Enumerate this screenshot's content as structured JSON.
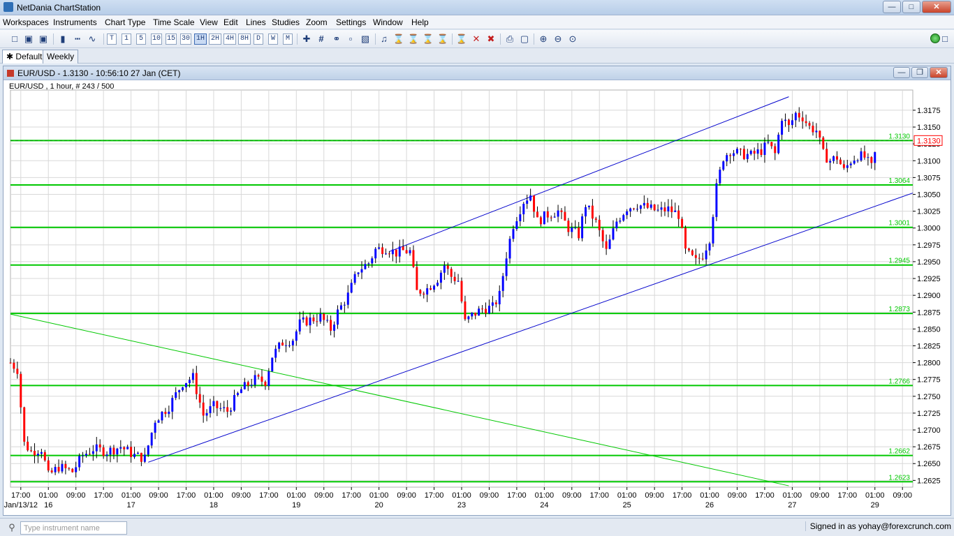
{
  "app": {
    "title": "NetDania ChartStation",
    "status_color": "#1b8f1b"
  },
  "menu": [
    "Workspaces",
    "Instruments",
    "Chart Type",
    "Time Scale",
    "View",
    "Edit",
    "Lines",
    "Studies",
    "Zoom",
    "Settings",
    "Window",
    "Help"
  ],
  "toolbar": {
    "timeframes": [
      "T",
      "1",
      "5",
      "10",
      "15",
      "30",
      "1H",
      "2H",
      "4H",
      "8H",
      "D",
      "W",
      "M"
    ],
    "selected_timeframe": "1H",
    "icons": [
      "new-icon",
      "save-icon",
      "save-as-icon",
      "candlestick-icon",
      "bar-icon",
      "line-icon",
      "crosshair-icon",
      "grid-icon",
      "marker-icon",
      "histogram-icon",
      "volume-icon",
      "alert-icon",
      "study-icon",
      "trend-icon",
      "study-b-icon",
      "study-c-icon",
      "delete-last-icon",
      "delete-icon",
      "delete-all-icon",
      "print-icon",
      "print-preview-icon",
      "zoom-in-icon",
      "zoom-out-icon",
      "zoom-reset-icon"
    ]
  },
  "tabs": [
    {
      "label": "Default",
      "active": true
    },
    {
      "label": "Weekly",
      "active": false
    }
  ],
  "chart_window": {
    "title": "EUR/USD - 1.3130 - 10:56:10  27 Jan (CET)",
    "info": "EUR/USD , 1 hour, # 243 / 500"
  },
  "chart_data": {
    "type": "candlestick",
    "instrument": "EUR/USD",
    "interval": "1 hour",
    "current_price": "1.3130",
    "ylim": [
      1.2615,
      1.3205
    ],
    "y_ticks": [
      "1.3175",
      "1.3150",
      "1.3125",
      "1.3100",
      "1.3075",
      "1.3050",
      "1.3025",
      "1.3000",
      "1.2975",
      "1.2950",
      "1.2925",
      "1.2900",
      "1.2875",
      "1.2850",
      "1.2825",
      "1.2800",
      "1.2775",
      "1.2750",
      "1.2725",
      "1.2700",
      "1.2675",
      "1.2650",
      "1.2625"
    ],
    "x_ticks": [
      {
        "t": 17,
        "time": "17:00",
        "date": "Jan/13/12"
      },
      {
        "t": 25,
        "time": "01:00",
        "date": "16"
      },
      {
        "t": 33,
        "time": "09:00",
        "date": ""
      },
      {
        "t": 41,
        "time": "17:00",
        "date": ""
      },
      {
        "t": 49,
        "time": "01:00",
        "date": "17"
      },
      {
        "t": 57,
        "time": "09:00",
        "date": ""
      },
      {
        "t": 65,
        "time": "17:00",
        "date": ""
      },
      {
        "t": 73,
        "time": "01:00",
        "date": "18"
      },
      {
        "t": 81,
        "time": "09:00",
        "date": ""
      },
      {
        "t": 89,
        "time": "17:00",
        "date": ""
      },
      {
        "t": 97,
        "time": "01:00",
        "date": "19"
      },
      {
        "t": 105,
        "time": "09:00",
        "date": ""
      },
      {
        "t": 113,
        "time": "17:00",
        "date": ""
      },
      {
        "t": 121,
        "time": "01:00",
        "date": "20"
      },
      {
        "t": 129,
        "time": "09:00",
        "date": ""
      },
      {
        "t": 137,
        "time": "17:00",
        "date": ""
      },
      {
        "t": 145,
        "time": "01:00",
        "date": "23"
      },
      {
        "t": 153,
        "time": "09:00",
        "date": ""
      },
      {
        "t": 161,
        "time": "17:00",
        "date": ""
      },
      {
        "t": 169,
        "time": "01:00",
        "date": "24"
      },
      {
        "t": 177,
        "time": "09:00",
        "date": ""
      },
      {
        "t": 185,
        "time": "17:00",
        "date": ""
      },
      {
        "t": 193,
        "time": "01:00",
        "date": "25"
      },
      {
        "t": 201,
        "time": "09:00",
        "date": ""
      },
      {
        "t": 209,
        "time": "17:00",
        "date": ""
      },
      {
        "t": 217,
        "time": "01:00",
        "date": "26"
      },
      {
        "t": 225,
        "time": "09:00",
        "date": ""
      },
      {
        "t": 233,
        "time": "17:00",
        "date": ""
      },
      {
        "t": 241,
        "time": "01:00",
        "date": "27"
      },
      {
        "t": 249,
        "time": "09:00",
        "date": ""
      },
      {
        "t": 257,
        "time": "17:00",
        "date": ""
      },
      {
        "t": 265,
        "time": "01:00",
        "date": "29"
      },
      {
        "t": 273,
        "time": "09:00",
        "date": ""
      }
    ],
    "x_range": [
      14,
      276
    ],
    "levels": [
      {
        "value": 1.313,
        "label": "1.3130",
        "color": "#00c800"
      },
      {
        "value": 1.3064,
        "label": "1.3064",
        "color": "#00c800"
      },
      {
        "value": 1.3001,
        "label": "1.3001",
        "color": "#00c800"
      },
      {
        "value": 1.2945,
        "label": "1.2945",
        "color": "#00c800"
      },
      {
        "value": 1.2873,
        "label": "1.2873",
        "color": "#00c800"
      },
      {
        "value": 1.2766,
        "label": "1.2766",
        "color": "#00c800"
      },
      {
        "value": 1.2662,
        "label": "1.2662",
        "color": "#00c800"
      },
      {
        "value": 1.2623,
        "label": "1.2623",
        "color": "#00c800"
      }
    ],
    "trendlines": [
      {
        "from": [
          14,
          1.2872
        ],
        "to": [
          240,
          1.2617
        ],
        "color": "#00c800"
      },
      {
        "from": [
          54,
          1.2652
        ],
        "to": [
          276,
          1.3052
        ],
        "color": "#0000cc"
      },
      {
        "from": [
          124,
          1.2965
        ],
        "to": [
          240,
          1.3195
        ],
        "color": "#0000cc"
      }
    ],
    "path_points": [
      [
        14,
        1.28
      ],
      [
        16,
        1.279
      ],
      [
        18,
        1.268
      ],
      [
        20,
        1.2668
      ],
      [
        23,
        1.2672
      ],
      [
        25,
        1.2632
      ],
      [
        28,
        1.2645
      ],
      [
        32,
        1.2638
      ],
      [
        35,
        1.2662
      ],
      [
        38,
        1.2672
      ],
      [
        42,
        1.2668
      ],
      [
        46,
        1.2675
      ],
      [
        50,
        1.2662
      ],
      [
        53,
        1.2658
      ],
      [
        56,
        1.2715
      ],
      [
        60,
        1.2735
      ],
      [
        64,
        1.277
      ],
      [
        67,
        1.2778
      ],
      [
        70,
        1.2722
      ],
      [
        73,
        1.2735
      ],
      [
        77,
        1.2728
      ],
      [
        81,
        1.276
      ],
      [
        85,
        1.2775
      ],
      [
        88,
        1.2772
      ],
      [
        90,
        1.281
      ],
      [
        93,
        1.283
      ],
      [
        96,
        1.2835
      ],
      [
        98,
        1.2858
      ],
      [
        100,
        1.2862
      ],
      [
        104,
        1.2868
      ],
      [
        107,
        1.285
      ],
      [
        109,
        1.2875
      ],
      [
        112,
        1.29
      ],
      [
        115,
        1.2938
      ],
      [
        118,
        1.2948
      ],
      [
        120,
        1.2968
      ],
      [
        123,
        1.297
      ],
      [
        126,
        1.2963
      ],
      [
        128,
        1.2966
      ],
      [
        130,
        1.2965
      ],
      [
        132,
        1.2905
      ],
      [
        135,
        1.291
      ],
      [
        138,
        1.2925
      ],
      [
        140,
        1.2945
      ],
      [
        142,
        1.2928
      ],
      [
        144,
        1.2922
      ],
      [
        146,
        1.286
      ],
      [
        148,
        1.287
      ],
      [
        151,
        1.288
      ],
      [
        154,
        1.2882
      ],
      [
        156,
        1.29
      ],
      [
        158,
        1.296
      ],
      [
        160,
        1.3005
      ],
      [
        163,
        1.304
      ],
      [
        165,
        1.305
      ],
      [
        167,
        1.301
      ],
      [
        170,
        1.302
      ],
      [
        173,
        1.3025
      ],
      [
        176,
        1.3
      ],
      [
        179,
        1.299
      ],
      [
        181,
        1.3035
      ],
      [
        184,
        1.3008
      ],
      [
        187,
        1.2965
      ],
      [
        190,
        1.301
      ],
      [
        193,
        1.303
      ],
      [
        196,
        1.3035
      ],
      [
        199,
        1.303
      ],
      [
        202,
        1.3025
      ],
      [
        205,
        1.3028
      ],
      [
        208,
        1.302
      ],
      [
        210,
        1.2965
      ],
      [
        213,
        1.295
      ],
      [
        215,
        1.296
      ],
      [
        217,
        1.2985
      ],
      [
        219,
        1.306
      ],
      [
        221,
        1.3105
      ],
      [
        223,
        1.3115
      ],
      [
        226,
        1.311
      ],
      [
        229,
        1.3108
      ],
      [
        232,
        1.3115
      ],
      [
        234,
        1.3125
      ],
      [
        236,
        1.311
      ],
      [
        238,
        1.3165
      ],
      [
        240,
        1.315
      ],
      [
        242,
        1.317
      ],
      [
        244,
        1.3165
      ],
      [
        246,
        1.315
      ],
      [
        248,
        1.3145
      ],
      [
        250,
        1.311
      ],
      [
        252,
        1.31
      ],
      [
        254,
        1.3105
      ],
      [
        256,
        1.3085
      ],
      [
        258,
        1.31
      ],
      [
        260,
        1.3108
      ],
      [
        262,
        1.3105
      ],
      [
        264,
        1.309
      ],
      [
        266,
        1.313
      ]
    ],
    "colors": {
      "up": "#0000ff",
      "down": "#ff0000",
      "wick": "#000000",
      "grid": "#d8d8d8",
      "price_line": "#009900"
    }
  },
  "bottom": {
    "search_placeholder": "Type instrument name",
    "signed_in": "Signed in as yohay@forexcrunch.com"
  }
}
